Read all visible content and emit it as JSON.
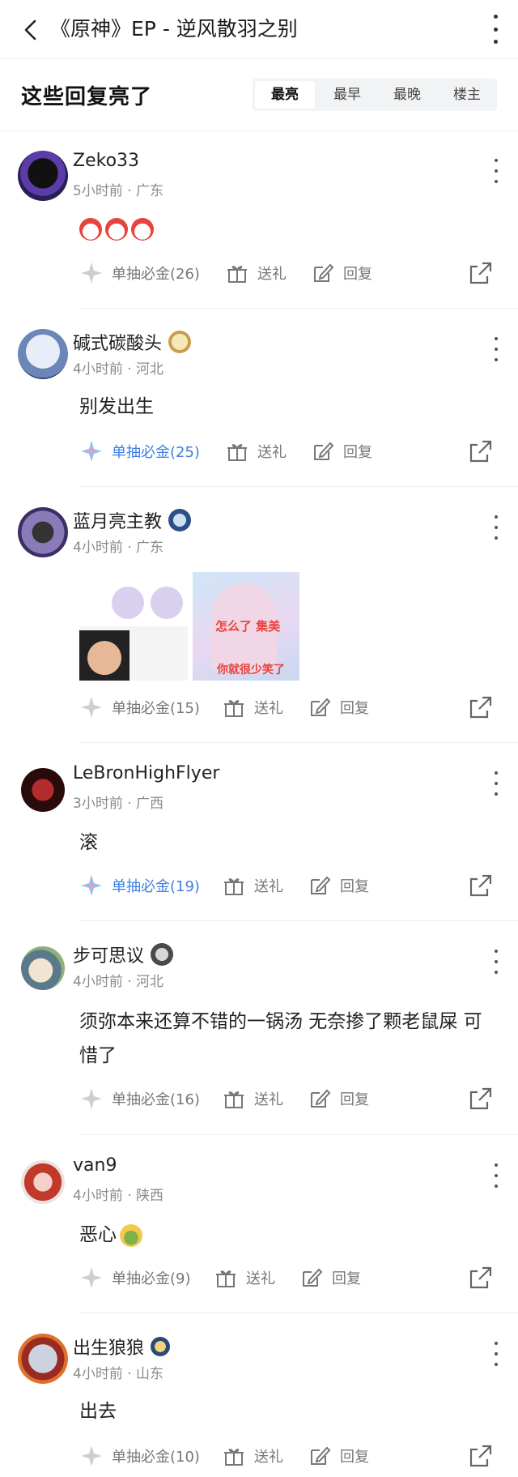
{
  "header": {
    "title": "《原神》EP - 逆风散羽之别"
  },
  "hot": {
    "title": "这些回复亮了",
    "tabs": [
      "最亮",
      "最早",
      "最晚",
      "楼主"
    ]
  },
  "actions": {
    "gift": "送礼",
    "reply": "回复"
  },
  "comments": [
    {
      "user": "Zeko33",
      "time": "5小时前",
      "region": "广东",
      "lucky": "单抽必金(26)",
      "lucky_active": false
    },
    {
      "user": "碱式碳酸头",
      "time": "4小时前",
      "region": "河北",
      "text": "别发出生",
      "lucky": "单抽必金(25)",
      "lucky_active": true
    },
    {
      "user": "蓝月亮主教",
      "time": "4小时前",
      "region": "广东",
      "lucky": "单抽必金(15)",
      "lucky_active": false,
      "meme_caption_top": "怎么了 集美",
      "meme_caption_bottom": "你就很少笑了"
    },
    {
      "user": "LeBronHighFlyer",
      "time": "3小时前",
      "region": "广西",
      "text": "滚",
      "lucky": "单抽必金(19)",
      "lucky_active": true
    },
    {
      "user": "步可思议",
      "time": "4小时前",
      "region": "河北",
      "text": "须弥本来还算不错的一锅汤 无奈掺了颗老鼠屎 可惜了",
      "lucky": "单抽必金(16)",
      "lucky_active": false
    },
    {
      "user": "van9",
      "time": "4小时前",
      "region": "陕西",
      "text": "恶心",
      "lucky": "单抽必金(9)",
      "lucky_active": false
    },
    {
      "user": "出生狼狼",
      "time": "4小时前",
      "region": "山东",
      "text": "出去",
      "lucky": "单抽必金(10)",
      "lucky_active": false
    }
  ],
  "colors": {
    "accent_blue": "#3f7ee4",
    "meta_gray": "#8a8a8a"
  }
}
